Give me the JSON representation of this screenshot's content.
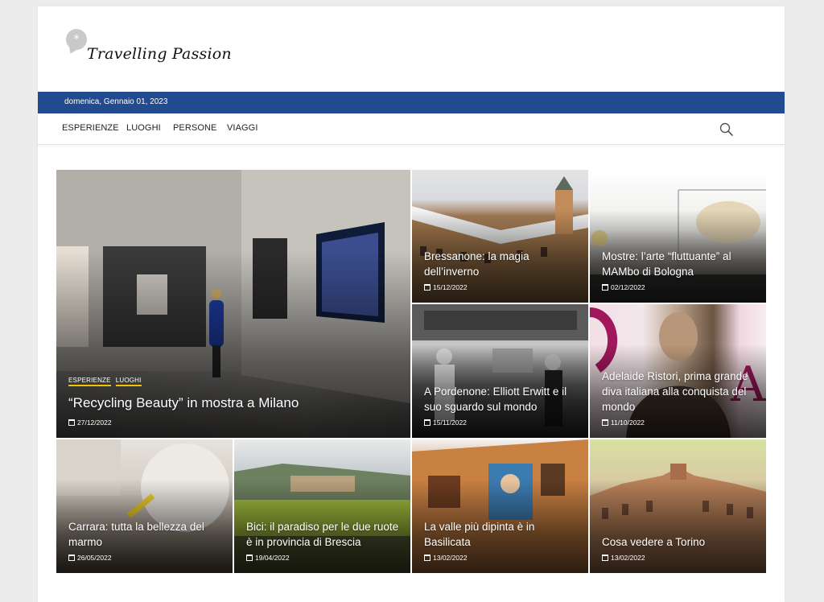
{
  "site": {
    "logo_text": "Travelling Passion",
    "logo_symbol": "*"
  },
  "topbar": {
    "date": "domenica, Gennaio 01, 2023"
  },
  "nav": {
    "items": [
      {
        "label": "ESPERIENZE"
      },
      {
        "label": "LUOGHI"
      },
      {
        "label": "PERSONE"
      },
      {
        "label": "VIAGGI"
      }
    ],
    "search_icon": "search-icon"
  },
  "colors": {
    "topbar": "#224b8f",
    "tag_underline": "#f2c200",
    "background": "#ececec"
  },
  "featured": {
    "tags": [
      "ESPERIENZE",
      "LUOGHI"
    ],
    "title": "“Recycling Beauty” in mostra a Milano",
    "date": "27/12/2022"
  },
  "posts": [
    {
      "title": "Bressanone: la magia dell’inverno",
      "date": "15/12/2022"
    },
    {
      "title": "Mostre: l’arte “fluttuante” al MAMbo di Bologna",
      "date": "02/12/2022"
    },
    {
      "title": "A Pordenone: Elliott Erwitt e il suo sguardo sul mondo",
      "date": "15/11/2022"
    },
    {
      "title": "Adelaide Ristori, prima grande diva italiana alla conquista del mondo",
      "date": "11/10/2022"
    },
    {
      "title": "Carrara: tutta la bellezza del marmo",
      "date": "26/05/2022"
    },
    {
      "title": "Bici: il paradiso per le due ruote è in provincia di Brescia",
      "date": "19/04/2022"
    },
    {
      "title": "La valle più dipinta è in Basilicata",
      "date": "13/02/2022"
    },
    {
      "title": "Cosa vedere a Torino",
      "date": "13/02/2022"
    }
  ]
}
